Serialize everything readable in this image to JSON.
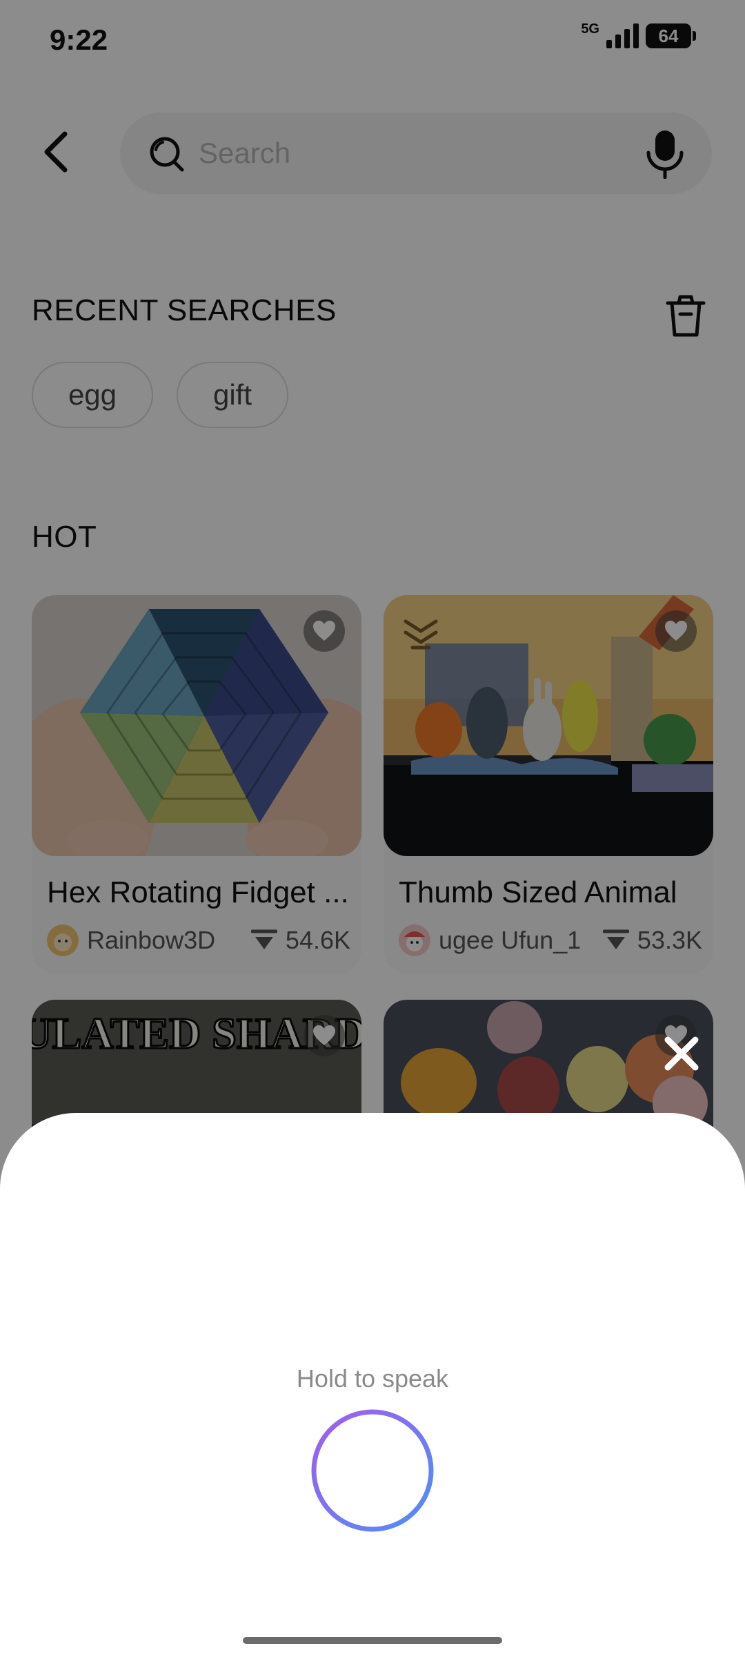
{
  "status_bar": {
    "time": "9:22",
    "network": "5G",
    "battery": "64"
  },
  "search": {
    "placeholder": "Search",
    "value": ""
  },
  "recent": {
    "title": "RECENT SEARCHES",
    "items": [
      "egg",
      "gift"
    ]
  },
  "hot": {
    "title": "HOT",
    "cards": [
      {
        "title": "Hex Rotating Fidget ...",
        "author": "Rainbow3D",
        "downloads": "54.6K"
      },
      {
        "title": "Thumb Sized Animal",
        "author": "ugee Ufun_1",
        "downloads": "53.3K"
      },
      {
        "title": "",
        "author": "",
        "downloads": "",
        "image_text": "ARTICULATED SHARDSCALE"
      },
      {
        "title": "",
        "author": "",
        "downloads": ""
      }
    ]
  },
  "voice_sheet": {
    "hint": "Hold to speak"
  },
  "icons": {
    "back": "chevron-left-icon",
    "search": "search-icon",
    "mic": "microphone-icon",
    "trash": "trash-icon",
    "favorite": "heart-icon",
    "download": "download-icon",
    "close": "close-icon",
    "voice": "voice-wave-icon"
  },
  "colors": {
    "accent_gradient_start": "#8a5cf6",
    "accent_gradient_end": "#5b8ff9",
    "overlay": "rgba(0,0,0,0.45)"
  }
}
